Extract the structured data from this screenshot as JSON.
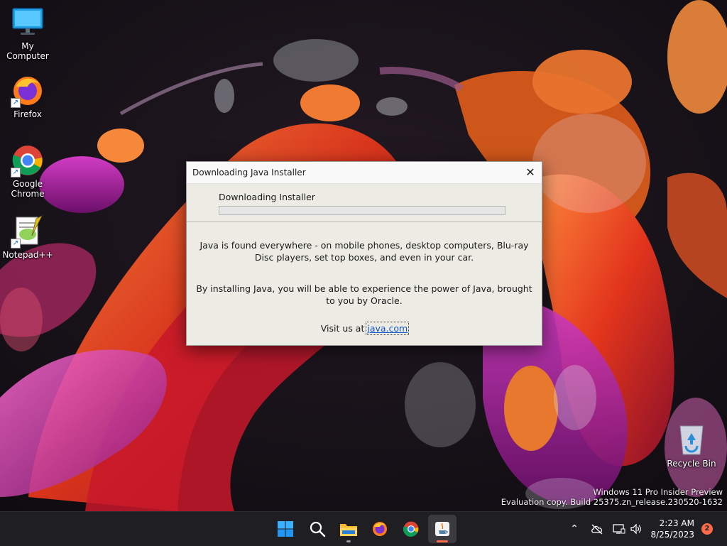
{
  "desktop": {
    "icons": [
      {
        "label": "My Computer",
        "icon": "monitor-icon"
      },
      {
        "label": "Firefox",
        "icon": "firefox-icon"
      },
      {
        "label": "Google Chrome",
        "icon": "chrome-icon"
      },
      {
        "label": "Notepad++",
        "icon": "notepad-plus-plus-icon"
      },
      {
        "label": "Recycle Bin",
        "icon": "recycle-bin-icon"
      }
    ]
  },
  "dialog": {
    "title": "Downloading Java Installer",
    "close_glyph": "✕",
    "status": "Downloading Installer",
    "progress": 0,
    "paragraph1": "Java is found everywhere - on mobile phones, desktop computers, Blu-ray Disc players, set top boxes, and even in your car.",
    "paragraph2": "By installing Java, you will be able to experience the power of Java, brought to you by Oracle.",
    "visit_prefix": "Visit us at ",
    "visit_link": "java.com"
  },
  "watermark": {
    "line1": "Windows 11 Pro Insider Preview",
    "line2": "Evaluation copy. Build 25375.zn_release.230520-1632"
  },
  "taskbar": {
    "apps": [
      {
        "name": "start",
        "icon": "windows-start-icon"
      },
      {
        "name": "search",
        "icon": "search-icon"
      },
      {
        "name": "file-explorer",
        "icon": "folder-icon"
      },
      {
        "name": "firefox",
        "icon": "firefox-icon"
      },
      {
        "name": "chrome",
        "icon": "chrome-icon"
      },
      {
        "name": "java",
        "icon": "java-icon",
        "active": true
      }
    ],
    "tray": {
      "overflow_glyph": "⌃",
      "time": "2:23 AM",
      "date": "8/25/2023",
      "notification_count": "2"
    }
  },
  "colors": {
    "taskbar_bg": "#1f1f23",
    "dialog_bg": "#ecebe4",
    "link": "#1155cc",
    "accent": "#ff6b4a"
  }
}
